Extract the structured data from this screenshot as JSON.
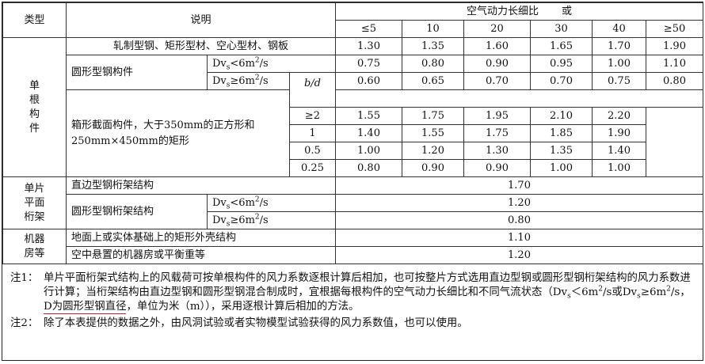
{
  "header": {
    "type": "类型",
    "desc": "说明",
    "ratio_title": "空气动力长细比",
    "or": "或",
    "cols": [
      "≤5",
      "10",
      "20",
      "30",
      "40",
      "≥50"
    ]
  },
  "rows": {
    "rolled": {
      "label": "轧制型钢、矩形型材、空心型材、钢板",
      "vals": [
        "1.30",
        "1.35",
        "1.60",
        "1.65",
        "1.70",
        "1.90"
      ]
    },
    "round": {
      "label": "圆形型钢构件",
      "lt_pre": "Dv",
      "lt_sub": "s",
      "lt_mid": "<6m",
      "lt_sup": "2",
      "lt_post": "/s",
      "ge_pre": "Dv",
      "ge_sub": "s",
      "ge_mid": "≥6m",
      "ge_sup": "2",
      "ge_post": "/s",
      "vals_lt": [
        "0.75",
        "0.80",
        "0.90",
        "0.95",
        "1.00",
        "1.10"
      ],
      "vals_ge": [
        "0.60",
        "0.65",
        "0.70",
        "0.70",
        "0.75",
        "0.80"
      ]
    },
    "box": {
      "label": "箱形截面构件，大于350mm的正方形和250mm×450mm的矩形",
      "bd": "b/d",
      "sub": [
        {
          "bd": "≥2",
          "vals": [
            "1.55",
            "1.75",
            "1.95",
            "2.10",
            "2.20"
          ]
        },
        {
          "bd": "1",
          "vals": [
            "1.40",
            "1.55",
            "1.75",
            "1.85",
            "1.90"
          ]
        },
        {
          "bd": "0.5",
          "vals": [
            "1.00",
            "1.20",
            "1.30",
            "1.35",
            "1.40"
          ]
        },
        {
          "bd": "0.25",
          "vals": [
            "0.80",
            "0.90",
            "0.90",
            "1.00",
            "1.00"
          ]
        }
      ]
    }
  },
  "categories": {
    "single": "单根构件",
    "truss": "单片平面桁架",
    "room": "机器房等"
  },
  "truss": {
    "straight": {
      "label": "直边型钢桁架结构",
      "val": "1.70"
    },
    "round": {
      "label": "圆形型钢桁架结构",
      "lt_val": "1.20",
      "ge_val": "0.80"
    }
  },
  "room": {
    "ground": {
      "label": "地面上或实体基础上的矩形外壳结构",
      "val": "1.10"
    },
    "air": {
      "label": "空中悬置的机器房或平衡重等",
      "val": "1.20"
    }
  },
  "notes": {
    "n1_tag": "注1：",
    "n1_a": "单片平面桁架式结构上的风载荷可按单根构件的风力系数逐根计算后相加，也可按整片方式选用直边型钢或圆形型钢桁架结构的风力系数进行计算；当桁架结构由直边型钢和圆形型钢混合制成时，宜根据每根构件的空气动力长细比和不同气流状态（Dv",
    "n1_s1": "s",
    "n1_b": "＜6m",
    "n1_c": "/s或Dv",
    "n1_s2": "s",
    "n1_d": "≥6m",
    "n1_e": "/s，",
    "n1_hl": "D为圆形型钢直径",
    "n1_f": "，单位为米（m））",
    "n1_g": "，采用逐根计算后相加的方法。",
    "sup2": "2",
    "n2_tag": "注2：",
    "n2": "除了本表提供的数据之外，由风洞试验或者实物模型试验获得的风力系数值，也可以使用。"
  },
  "colors": {
    "underline": "#d42020"
  }
}
